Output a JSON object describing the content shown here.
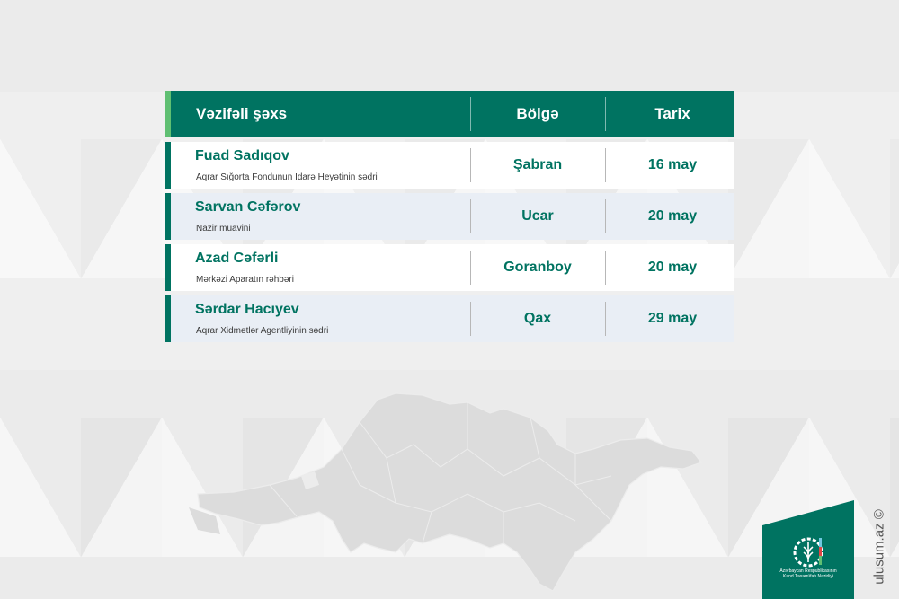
{
  "header": {
    "person": "Vəzifəli şəxs",
    "region": "Bölgə",
    "date": "Tarix"
  },
  "rows": [
    {
      "name": "Fuad Sadıqov",
      "role": "Aqrar Sığorta Fondunun İdarə Heyətinin sədri",
      "region": "Şabran",
      "date": "16 may"
    },
    {
      "name": "Sarvan Cəfərov",
      "role": "Nazir müavini",
      "region": "Ucar",
      "date": "20 may"
    },
    {
      "name": "Azad Cəfərli",
      "role": "Mərkəzi Aparatın rəhbəri",
      "region": "Goranboy",
      "date": "20 may"
    },
    {
      "name": "Sərdar Hacıyev",
      "role": "Aqrar Xidmətlər Agentliyinin sədri",
      "region": "Qax",
      "date": "29 may"
    }
  ],
  "logo": {
    "line1": "Azərbaycan Respublikasının",
    "line2": "Kənd Təsərrüfatı Nazirliyi"
  },
  "credit": "ulusum.az ©",
  "colors": {
    "brand": "#007361",
    "accent": "#5fbf72",
    "row_tint": "#e9eef5"
  }
}
